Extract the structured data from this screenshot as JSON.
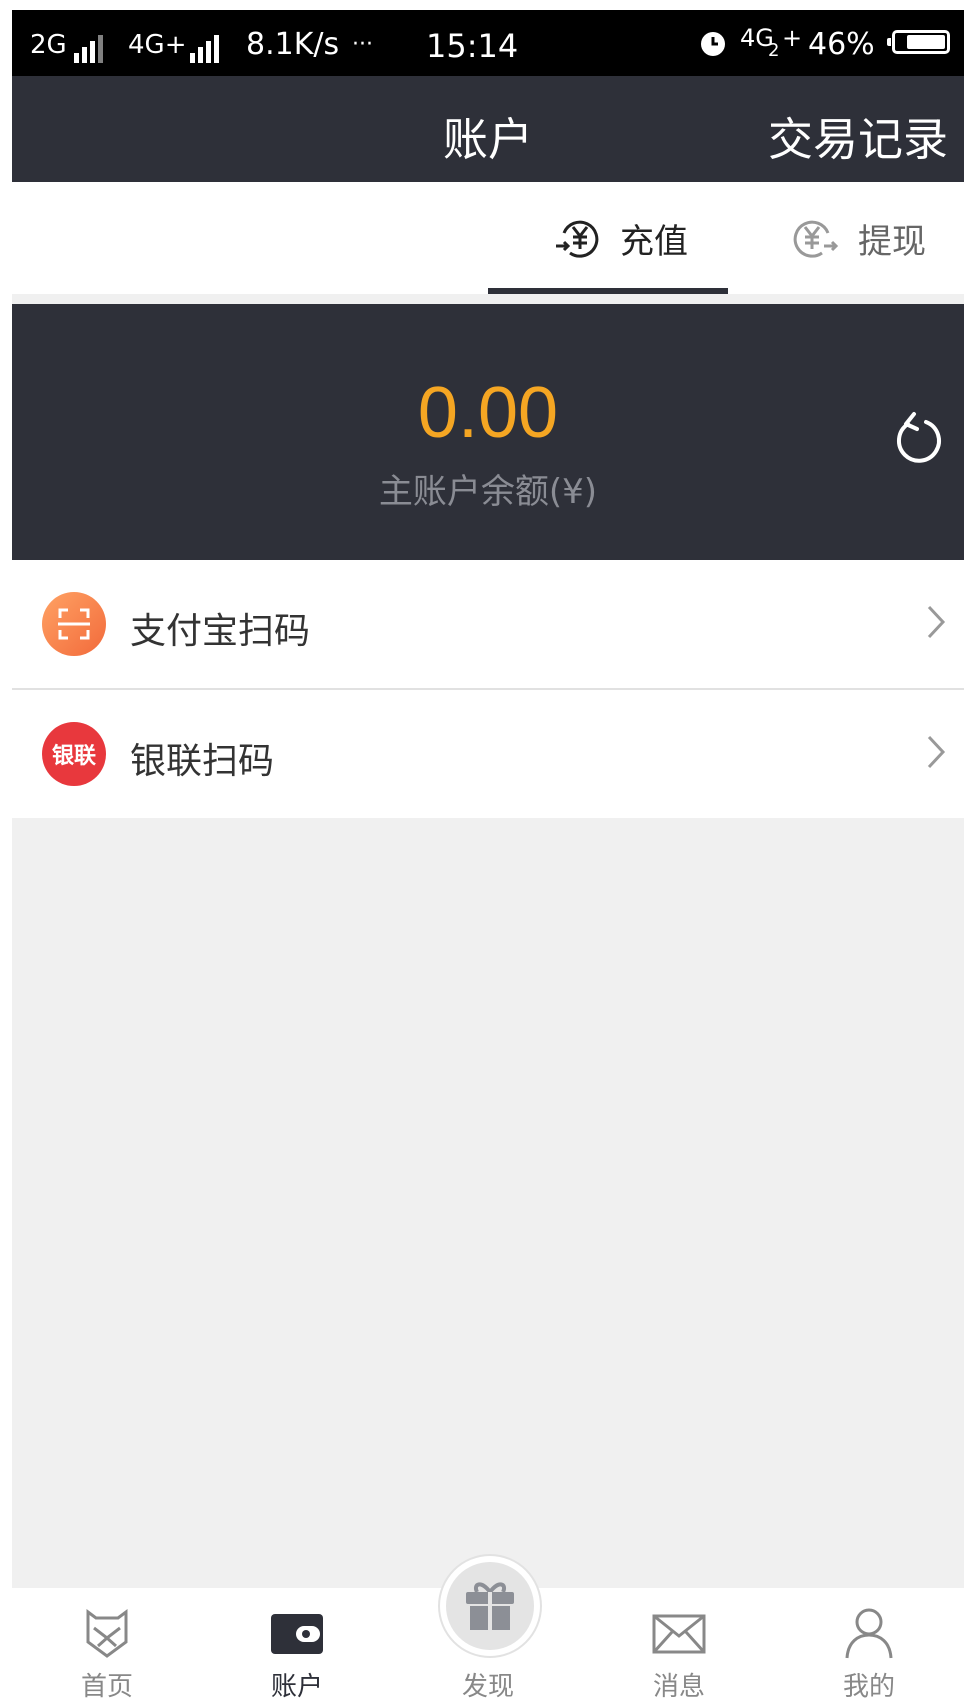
{
  "status_bar": {
    "left_network_1": "2G",
    "left_network_2": "4G+",
    "speed": "8.1K/s",
    "more": "···",
    "time": "15:14",
    "right_network": "4G",
    "right_network_sub": "2",
    "right_network_plus": "+",
    "battery": "46%"
  },
  "header": {
    "title": "账户",
    "right_action": "交易记录"
  },
  "tabs": [
    {
      "label": "充值",
      "icon": "yen-in-icon",
      "active": true
    },
    {
      "label": "提现",
      "icon": "yen-out-icon",
      "active": false
    }
  ],
  "balance": {
    "amount": "0.00",
    "label": "主账户余额(¥)"
  },
  "payment_methods": [
    {
      "label": "支付宝扫码",
      "icon": "scan-icon"
    },
    {
      "label": "银联扫码",
      "icon": "unionpay-icon",
      "icon_text": "银联"
    }
  ],
  "bottom_nav": [
    {
      "label": "首页",
      "icon": "home-icon",
      "active": false
    },
    {
      "label": "账户",
      "icon": "wallet-icon",
      "active": true
    },
    {
      "label": "发现",
      "icon": "gift-icon",
      "active": false
    },
    {
      "label": "消息",
      "icon": "mail-icon",
      "active": false
    },
    {
      "label": "我的",
      "icon": "user-icon",
      "active": false
    }
  ],
  "colors": {
    "header_bg": "#2e3039",
    "amount": "#f5a623",
    "alipay_gradient_start": "#ff9a5a",
    "alipay_gradient_end": "#f26a3b",
    "unionpay": "#e8383d"
  }
}
